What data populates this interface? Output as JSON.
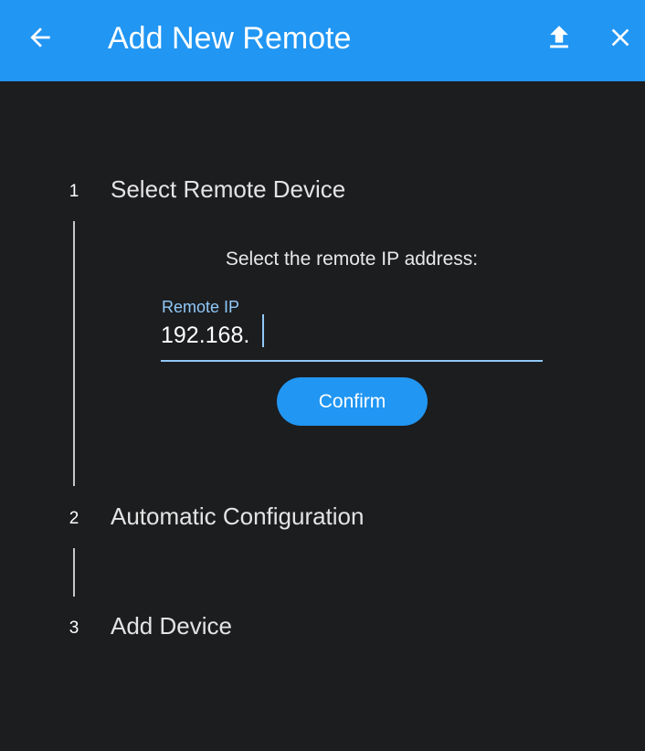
{
  "header": {
    "title": "Add New Remote",
    "icons": [
      "arrow-back-icon",
      "upload-icon",
      "close-icon"
    ],
    "background_color": "#2196f3"
  },
  "steps": [
    {
      "number": "1",
      "label": "Select Remote Device",
      "active": true
    },
    {
      "number": "2",
      "label": "Automatic Configuration",
      "active": false
    },
    {
      "number": "3",
      "label": "Add Device",
      "active": false
    }
  ],
  "step1": {
    "instruction": "Select the remote IP address:",
    "remote_ip_label": "Remote IP",
    "remote_ip_value": "192.168.",
    "confirm_label": "Confirm"
  },
  "colors": {
    "accent": "#2196f3",
    "field_accent": "#90c8f8",
    "background": "#1c1d1f"
  }
}
